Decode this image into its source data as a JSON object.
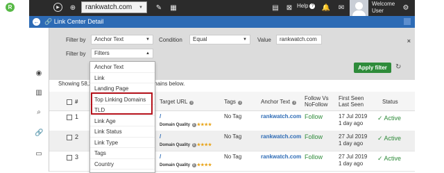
{
  "topbar": {
    "logo_letter": "R",
    "domain": "rankwatch.com",
    "help_label": "Help",
    "welcome_line1": "Welcome",
    "welcome_line2": "User"
  },
  "titlebar": {
    "title": "Link Center Detail"
  },
  "filters": {
    "filter_by_label": "Filter by",
    "filter_by_value": "Anchor Text",
    "condition_label": "Condition",
    "condition_value": "Equal",
    "value_label": "Value",
    "value_input": "rankwatch.com",
    "filter_by2_label": "Filter by",
    "filter_by2_value": "Filters",
    "apply_label": "Apply filter"
  },
  "showing": {
    "left": "Showing 58,2",
    "right": "s 83 Domains below."
  },
  "dropdown_options": [
    "Anchor Text",
    "Link",
    "Landing Page",
    "Top Linking Domains",
    "TLD",
    "Link Age",
    "Link Status",
    "Link Type",
    "Tags",
    "Country"
  ],
  "table": {
    "headers": {
      "hash": "#",
      "target_url": "Target URL",
      "tags": "Tags",
      "anchor_text": "Anchor Text",
      "follow_vs": "Follow Vs",
      "nofollow": "NoFollow",
      "first_seen": "First Seen",
      "last_seen": "Last Seen",
      "status": "Status"
    },
    "rows": [
      {
        "num": "1",
        "url": "/",
        "dq_label": "Domain Quality",
        "stars": "★★★★",
        "tag": "No Tag",
        "anchor": "rankwatch.com",
        "follow": "Follow",
        "date": "17 Jul 2019",
        "ago": "1 day ago",
        "status": "Active"
      },
      {
        "num": "2",
        "url": "/",
        "dq_label": "Domain Quality",
        "stars": "★★★★",
        "tag": "No Tag",
        "anchor": "rankwatch.com",
        "follow": "Follow",
        "date": "27 Jul 2019",
        "ago": "1 day ago",
        "status": "Active"
      },
      {
        "num": "3",
        "url": "/",
        "dq_label": "Domain Quality",
        "stars": "★★★★",
        "tag": "No Tag",
        "anchor": "rankwatch.com",
        "follow": "Follow",
        "date": "27 Jul 2019",
        "ago": "1 day ago",
        "status": "Active"
      }
    ]
  }
}
